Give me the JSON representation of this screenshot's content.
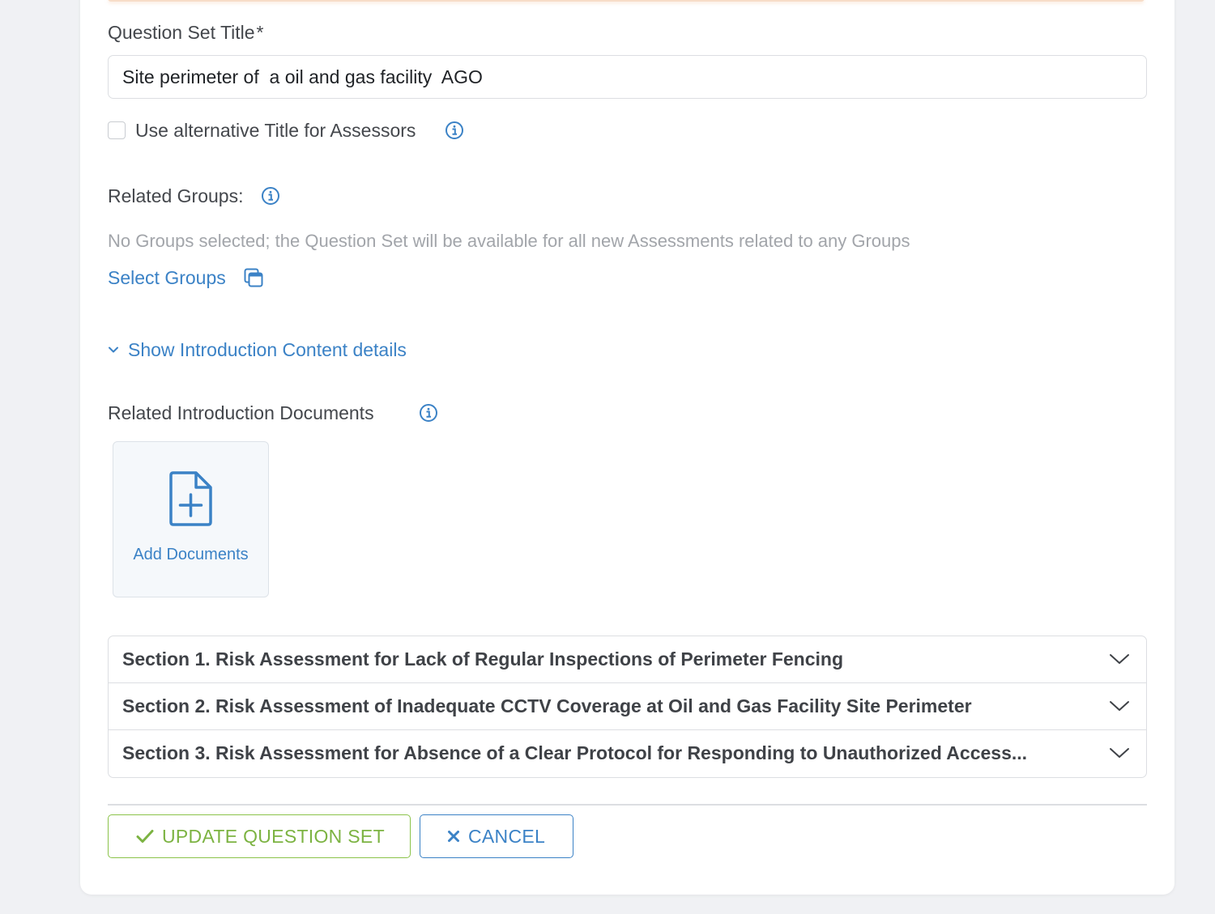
{
  "form": {
    "title_label": "Question Set Title",
    "required_marker": "*",
    "title_value": "Site perimeter of  a oil and gas facility  AGO",
    "alt_title_checkbox_label": "Use alternative Title for Assessors",
    "alt_title_checked": false,
    "related_groups_label": "Related Groups:",
    "no_groups_text": "No Groups selected; the Question Set will be available for all new Assessments related to any Groups",
    "select_groups_link": "Select Groups",
    "show_intro_link": "Show Introduction Content details",
    "related_docs_label": "Related Introduction Documents",
    "add_documents_label": "Add Documents"
  },
  "sections": [
    {
      "title": "Section 1. Risk Assessment for Lack of Regular Inspections of Perimeter Fencing"
    },
    {
      "title": "Section 2. Risk Assessment of Inadequate CCTV Coverage at Oil and Gas Facility Site Perimeter"
    },
    {
      "title": "Section 3. Risk Assessment for Absence of a Clear Protocol for Responding to Unauthorized Access..."
    }
  ],
  "actions": {
    "update_label": "UPDATE QUESTION SET",
    "cancel_label": "CANCEL"
  },
  "colors": {
    "link_blue": "#3b82c6",
    "update_green": "#7cb342",
    "border": "#dcdee2",
    "muted_text": "#a2a5aa"
  },
  "icons": {
    "info": "info-circle-icon",
    "select_groups": "window-stack-icon",
    "show_intro": "chevron-down-icon",
    "add_document": "file-plus-icon",
    "section_toggle": "chevron-down-icon",
    "update": "check-icon",
    "cancel": "close-icon"
  }
}
